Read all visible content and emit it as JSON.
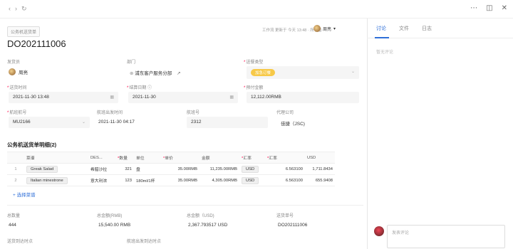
{
  "topbar": {
    "back_icon": "chevron-left-icon",
    "forward_icon": "chevron-right-icon",
    "refresh_icon": "refresh-icon",
    "more_icon": "more-icon",
    "panel_icon": "panel-icon",
    "close_icon": "close-icon"
  },
  "header": {
    "tag": "公务机送货单",
    "meta": "工作流 更新于 今天 13:48 · 所有者",
    "owner": "周亮",
    "title": "DO202111006"
  },
  "fields": {
    "sender_label": "发货员",
    "sender_value": "周亮",
    "dept_label": "部门",
    "dept_value": "浦东客户服务分部",
    "delivery_type_label": "送餐类型",
    "delivery_type_value": "加急订餐",
    "delivery_time_label": "送货时间",
    "delivery_time_value": "2021-11-30 13:48",
    "settle_date_label": "结算日期",
    "settle_date_value": "2021-11-30",
    "est_amount_label": "预付金额",
    "est_amount_value": "12,112.00RMB",
    "flight_label": "航班航号",
    "flight_value": "MU2166",
    "departure_label": "航班出发时间",
    "departure_value": "2021-11-30 04:17",
    "flight_no_label": "航班号",
    "flight_no_value": "2312",
    "agent_label": "代理公司",
    "agent_value": "佳捷（JSC)"
  },
  "section_title": "公务机送货单明细(2)",
  "table": {
    "headers": [
      "",
      "菜谱",
      "DES...",
      "数量",
      "单位",
      "单价",
      "金额",
      "汇率",
      "汇率",
      "USD"
    ],
    "rows": [
      [
        "1",
        "Greak Salad",
        "希腊沙拉",
        "321",
        "盘",
        "35.00RMB",
        "11,235.00RMB",
        "USD",
        "6.563100",
        "1,711.8434"
      ],
      [
        "2",
        "Italian minestrone",
        "意大利浓",
        "123",
        "180ml/1杯",
        "35.00RMB",
        "4,305.00RMB",
        "USD",
        "6.563100",
        "655.9408"
      ]
    ]
  },
  "add_dish": "+ 选择菜谱",
  "summary": {
    "total_qty_label": "总数量",
    "total_qty_value": "444",
    "total_rmb_label": "总金额(RMB)",
    "total_rmb_value": "15,540.00 RMB",
    "total_usd_label": "总金额（USD)",
    "total_usd_value": "2,367.793517 USD",
    "order_no_label": "送货单号",
    "order_no_value": "DO202111006"
  },
  "bottom": {
    "label1": "送货到达时点",
    "label2": "航班出发到达时点"
  },
  "side": {
    "tabs": [
      "讨论",
      "文件",
      "日志"
    ],
    "empty": "暂无评论",
    "comment_placeholder": "发表评论"
  }
}
